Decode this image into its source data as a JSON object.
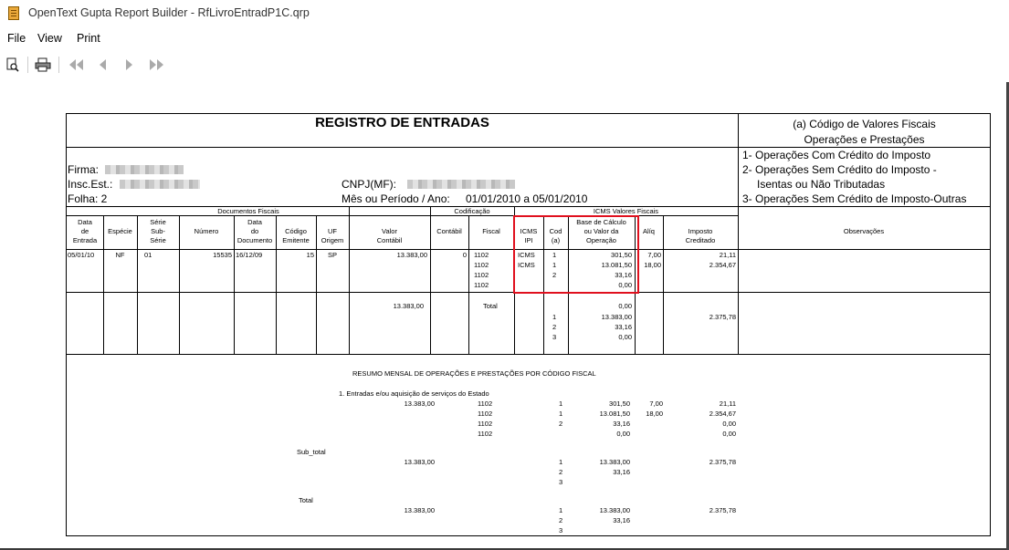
{
  "window": {
    "title": "OpenText Gupta Report Builder - RfLivroEntradP1C.qrp"
  },
  "menu": {
    "file": "File",
    "view": "View",
    "print": "Print"
  },
  "toolbar": {
    "icons": [
      "preview-icon",
      "print-icon",
      "first-page-icon",
      "prev-page-icon",
      "next-page-icon",
      "last-page-icon"
    ]
  },
  "report": {
    "title": "REGISTRO DE ENTRADAS",
    "codes": {
      "heading1": "(a) Código de Valores Fiscais",
      "heading2": "Operações e Prestações",
      "item1": "1- Operações Com Crédito do Imposto",
      "item2a": "2- Operações Sem Crédito do Imposto -",
      "item2b": "Isentas ou Não Tributadas",
      "item3": "3- Operações Sem Crédito de Imposto-Outras"
    },
    "header": {
      "firma_label": "Firma:",
      "insc_label": "Insc.Est.:",
      "folha": "Folha: 2",
      "cnpj_label": "CNPJ(MF):",
      "periodo_label": "Mês ou Período / Ano:",
      "periodo_value": "01/01/2010 a  05/01/2010"
    },
    "groups": {
      "documentos": "Documentos Fiscais",
      "codificacao": "Codificação",
      "icms": "ICMS Valores Fiscais"
    },
    "columns": {
      "data": [
        "Data",
        "de",
        "Entrada"
      ],
      "especie": "Espécie",
      "serie": [
        "Série",
        "Sub-",
        "Série"
      ],
      "numero": "Número",
      "data_doc": [
        "Data",
        "do",
        "Documento"
      ],
      "codigo": [
        "Código",
        "Emitente"
      ],
      "uf": [
        "UF",
        "Origem"
      ],
      "valor": [
        "Valor",
        "Contábil"
      ],
      "contabil": "Contábil",
      "fiscal": "Fiscal",
      "icms_ipi": [
        "ICMS",
        "IPI"
      ],
      "cod": [
        "Cod",
        "(a)"
      ],
      "base": [
        "Base de Cálculo",
        "ou Valor da",
        "Operação"
      ],
      "aliq": "Alíq",
      "imposto": [
        "Imposto",
        "Creditado"
      ],
      "obs": "Observações"
    },
    "entry": {
      "data": "05/01/10",
      "especie": "NF",
      "serie": "01",
      "numero": "15535",
      "data_doc": "16/12/09",
      "codigo": "15",
      "uf": "SP",
      "valor": "13.383,00",
      "contabil": "0",
      "rows": [
        {
          "fiscal": "1102",
          "icms": "ICMS",
          "cod": "1",
          "base": "301,50",
          "aliq": "7,00",
          "imposto": "21,11"
        },
        {
          "fiscal": "1102",
          "icms": "ICMS",
          "cod": "1",
          "base": "13.081,50",
          "aliq": "18,00",
          "imposto": "2.354,67"
        },
        {
          "fiscal": "1102",
          "icms": "",
          "cod": "2",
          "base": "33,16",
          "aliq": "",
          "imposto": ""
        },
        {
          "fiscal": "1102",
          "icms": "",
          "cod": "",
          "base": "0,00",
          "aliq": "",
          "imposto": ""
        }
      ]
    },
    "total": {
      "valor": "13.383,00",
      "label": "Total",
      "rows": [
        {
          "cod": "",
          "base": "0,00"
        },
        {
          "cod": "1",
          "base": "13.383,00"
        },
        {
          "cod": "2",
          "base": "33,16"
        },
        {
          "cod": "3",
          "base": "0,00"
        }
      ],
      "imposto": "2.375,78"
    },
    "resumo": {
      "title": "RESUMO MENSAL DE OPERAÇÕES E PRESTAÇÕES POR CÓDIGO FISCAL",
      "subtitle": "1. Entradas e/ou aquisição de serviços do Estado",
      "valor": "13.383,00",
      "rows": [
        {
          "fiscal": "1102",
          "cod": "1",
          "base": "301,50",
          "aliq": "7,00",
          "imposto": "21,11"
        },
        {
          "fiscal": "1102",
          "cod": "1",
          "base": "13.081,50",
          "aliq": "18,00",
          "imposto": "2.354,67"
        },
        {
          "fiscal": "1102",
          "cod": "2",
          "base": "33,16",
          "aliq": "",
          "imposto": "0,00"
        },
        {
          "fiscal": "1102",
          "cod": "",
          "base": "0,00",
          "aliq": "",
          "imposto": "0,00"
        }
      ],
      "subtotal": {
        "label": "Sub_total",
        "valor": "13.383,00",
        "rows": [
          {
            "cod": "1",
            "base": "13.383,00"
          },
          {
            "cod": "2",
            "base": "33,16"
          },
          {
            "cod": "3",
            "base": ""
          }
        ],
        "imposto": "2.375,78"
      },
      "total": {
        "label": "Total",
        "valor": "13.383,00",
        "rows": [
          {
            "cod": "1",
            "base": "13.383,00"
          },
          {
            "cod": "2",
            "base": "33,16"
          },
          {
            "cod": "3",
            "base": ""
          }
        ],
        "imposto": "2.375,78"
      }
    }
  }
}
